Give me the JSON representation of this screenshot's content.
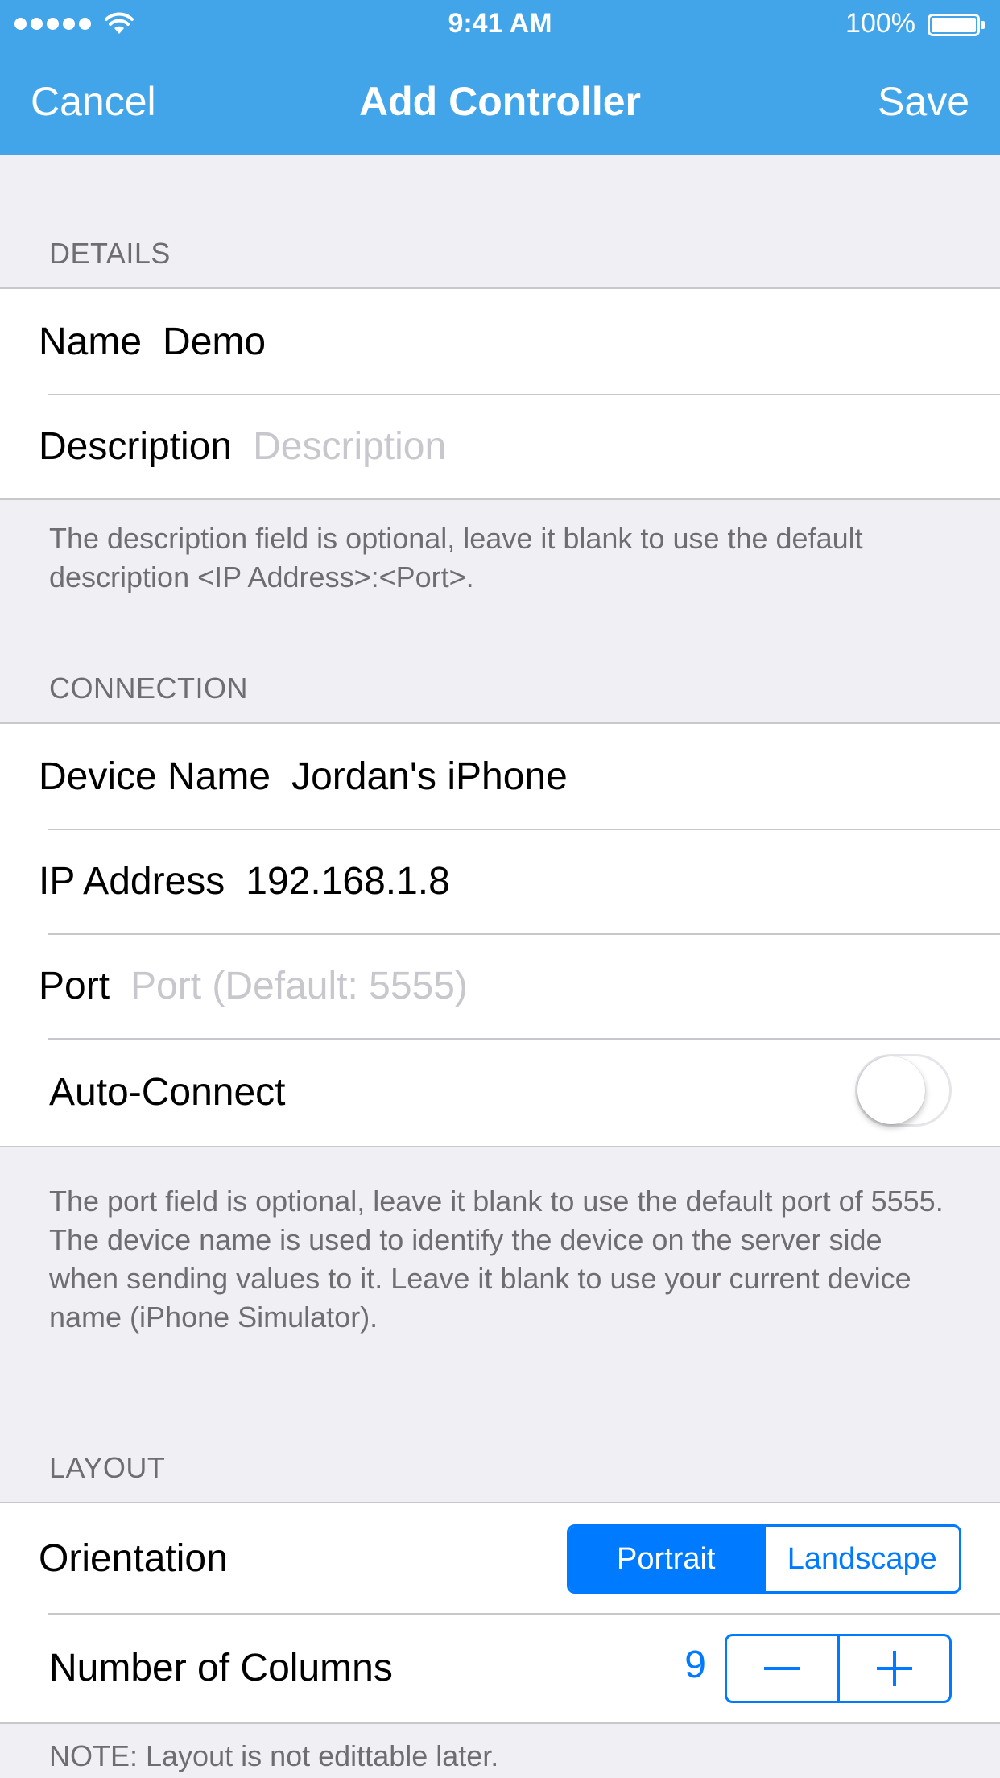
{
  "status_bar": {
    "time": "9:41 AM",
    "battery": "100%"
  },
  "nav": {
    "cancel_label": "Cancel",
    "title": "Add Controller",
    "save_label": "Save"
  },
  "details": {
    "header": "DETAILS",
    "name_label": "Name",
    "name_value": "Demo",
    "description_label": "Description",
    "description_placeholder": "Description",
    "footer": "The description field is optional, leave it blank to use the default description <IP Address>:<Port>."
  },
  "connection": {
    "header": "CONNECTION",
    "device_name_label": "Device Name",
    "device_name_value": "Jordan's iPhone",
    "ip_label": "IP Address",
    "ip_value": "192.168.1.8",
    "port_label": "Port",
    "port_placeholder": "Port (Default: 5555)",
    "auto_connect_label": "Auto-Connect",
    "auto_connect_on": false,
    "footer_line1": "The port field is optional, leave it blank to use the default port of 5555.",
    "footer_line2": "The device name is used to identify the device on the server side when sending values to it. Leave it blank to use your current device name (iPhone Simulator)."
  },
  "layout": {
    "header": "LAYOUT",
    "orientation_label": "Orientation",
    "orientation_options": [
      "Portrait",
      "Landscape"
    ],
    "orientation_selected": "Portrait",
    "columns_label": "Number of Columns",
    "columns_value": "9",
    "footer": "NOTE: Layout is not edittable later."
  },
  "icons": {
    "signal": "signal-dots-icon",
    "wifi": "wifi-icon",
    "battery": "battery-icon",
    "minus": "minus-icon",
    "plus": "plus-icon"
  },
  "colors": {
    "nav_background": "#42a5ea",
    "tint": "#007aff",
    "grouped_background": "#efeff4",
    "secondary_text": "#6d6d72",
    "placeholder": "#c7c7cd"
  }
}
